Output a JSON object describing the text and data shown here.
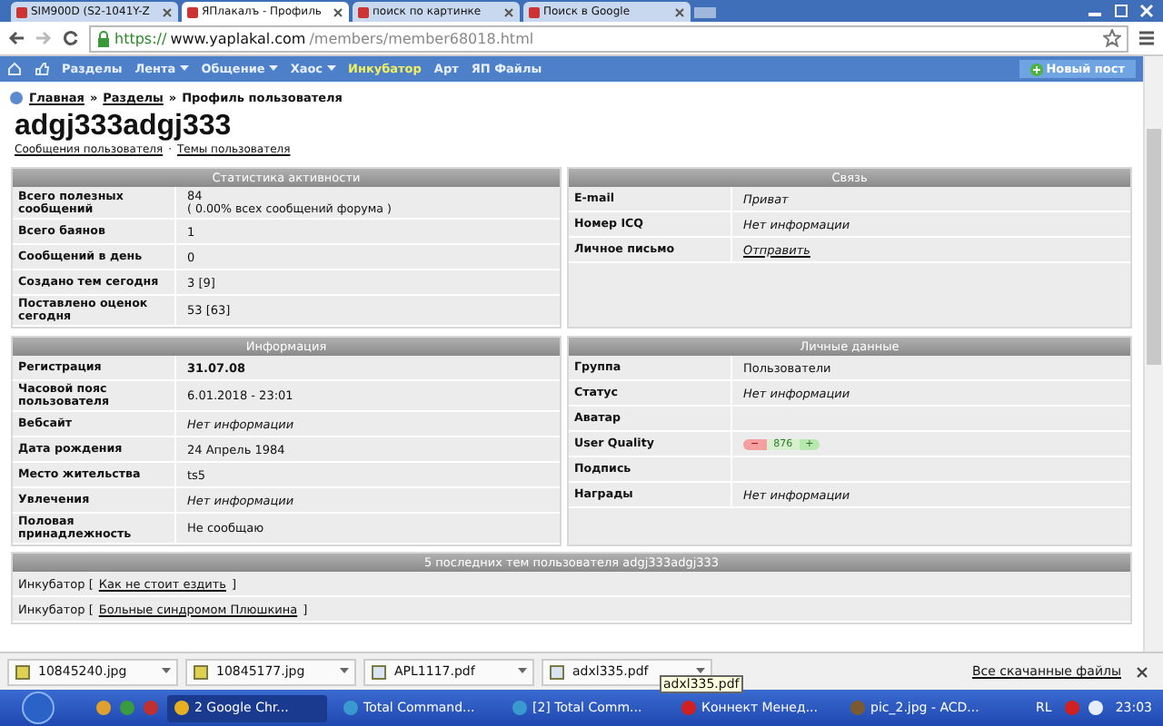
{
  "browser": {
    "tabs": [
      {
        "title": "SIM900D (S2-1041Y-Z",
        "selected": false
      },
      {
        "title": "ЯПлакалъ - Профиль",
        "selected": true
      },
      {
        "title": "поиск по картинке",
        "selected": false
      },
      {
        "title": "Поиск в Google",
        "selected": false
      }
    ],
    "url_secure": "https://",
    "url_host": "www.yaplakal.com",
    "url_path": "/members/member68018.html"
  },
  "nav": {
    "items": [
      {
        "label": "Разделы",
        "dropdown": false,
        "kind": "plain"
      },
      {
        "label": "Лента",
        "dropdown": true,
        "kind": "plain"
      },
      {
        "label": "Общение",
        "dropdown": true,
        "kind": "plain"
      },
      {
        "label": "Хаос",
        "dropdown": true,
        "kind": "plain"
      },
      {
        "label": "Инкубатор",
        "dropdown": false,
        "kind": "highlight"
      },
      {
        "label": "Арт",
        "dropdown": false,
        "kind": "plain"
      },
      {
        "label": "ЯП Файлы",
        "dropdown": false,
        "kind": "plain"
      }
    ],
    "new_post": "Новый пост"
  },
  "breadcrumb": {
    "links": [
      "Главная",
      "Разделы"
    ],
    "separator": "»",
    "current": "Профиль пользователя"
  },
  "profile": {
    "name": "adgj333adgj333",
    "links": [
      "Сообщения пользователя",
      "Темы пользователя"
    ],
    "link_separator": "·"
  },
  "stats": {
    "title": "Статистика активности",
    "rows": [
      {
        "label": "Всего полезных сообщений",
        "value": "84",
        "note": "( 0.00% всех сообщений форума )",
        "kind": "text"
      },
      {
        "label": "Всего баянов",
        "value": "1",
        "kind": "text"
      },
      {
        "label": "Сообщений в день",
        "value": "0",
        "kind": "text"
      },
      {
        "label": "Создано тем сегодня",
        "value": "3 [9]",
        "kind": "text"
      },
      {
        "label": "Поставлено оценок сегодня",
        "value": "53 [63]",
        "kind": "text"
      }
    ]
  },
  "contact": {
    "title": "Связь",
    "rows": [
      {
        "label": "E-mail",
        "value": "Приват",
        "kind": "italic"
      },
      {
        "label": "Номер ICQ",
        "value": "Нет информации",
        "kind": "italic"
      },
      {
        "label": "Личное письмо",
        "value": "Отправить",
        "kind": "link"
      }
    ]
  },
  "info": {
    "title": "Информация",
    "rows": [
      {
        "label": "Регистрация",
        "value": "31.07.08",
        "kind": "bold"
      },
      {
        "label": "Часовой пояс пользователя",
        "value": "6.01.2018 - 23:01",
        "kind": "text"
      },
      {
        "label": "Вебсайт",
        "value": "Нет информации",
        "kind": "italic"
      },
      {
        "label": "Дата рождения",
        "value": "24 Апрель 1984",
        "kind": "text"
      },
      {
        "label": "Место жительства",
        "value": "ts5",
        "kind": "text"
      },
      {
        "label": "Увлечения",
        "value": "Нет информации",
        "kind": "italic"
      },
      {
        "label": "Половая принадлежность",
        "value": "Не сообщаю",
        "kind": "text"
      }
    ]
  },
  "personal": {
    "title": "Личные данные",
    "rows": [
      {
        "label": "Группа",
        "value": "Пользователи",
        "kind": "text"
      },
      {
        "label": "Статус",
        "value": "Нет информации",
        "kind": "italic"
      },
      {
        "label": "Аватар",
        "kind": "empty"
      },
      {
        "label": "User Quality",
        "minus": "−",
        "value": "876",
        "plus": "+",
        "kind": "rating"
      },
      {
        "label": "Подпись",
        "kind": "empty"
      },
      {
        "label": "Награды",
        "value": "Нет информации",
        "kind": "italic"
      }
    ]
  },
  "topics": {
    "title": "5 последних тем пользователя adgj333adgj333",
    "rows": [
      {
        "prefix": "Инкубатор [",
        "link": "Как не стоит ездить",
        "suffix": "]"
      },
      {
        "prefix": "Инкубатор [",
        "link": "Больные синдромом Плюшкина",
        "suffix": "]"
      }
    ]
  },
  "downloads": {
    "files": [
      {
        "name": "10845240.jpg",
        "kind": "image"
      },
      {
        "name": "10845177.jpg",
        "kind": "image"
      },
      {
        "name": "APL1117.pdf",
        "kind": "pdf"
      },
      {
        "name": "adxl335.pdf",
        "kind": "pdf"
      }
    ],
    "tooltip": "adxl335.pdf",
    "show_all": "Все скачанные файлы"
  },
  "taskbar": {
    "items": [
      {
        "label": "2 Google Chr...",
        "kind": "chrome",
        "selected": true
      },
      {
        "label": "Total Command...",
        "kind": "commander",
        "selected": false
      },
      {
        "label": "[2] Total Comm...",
        "kind": "commander",
        "selected": false
      },
      {
        "label": "Коннект Менед...",
        "kind": "connect",
        "selected": false
      },
      {
        "label": "pic_2.jpg - ACD...",
        "kind": "viewer",
        "selected": false
      }
    ],
    "lang": "RL",
    "clock": "23:03"
  }
}
